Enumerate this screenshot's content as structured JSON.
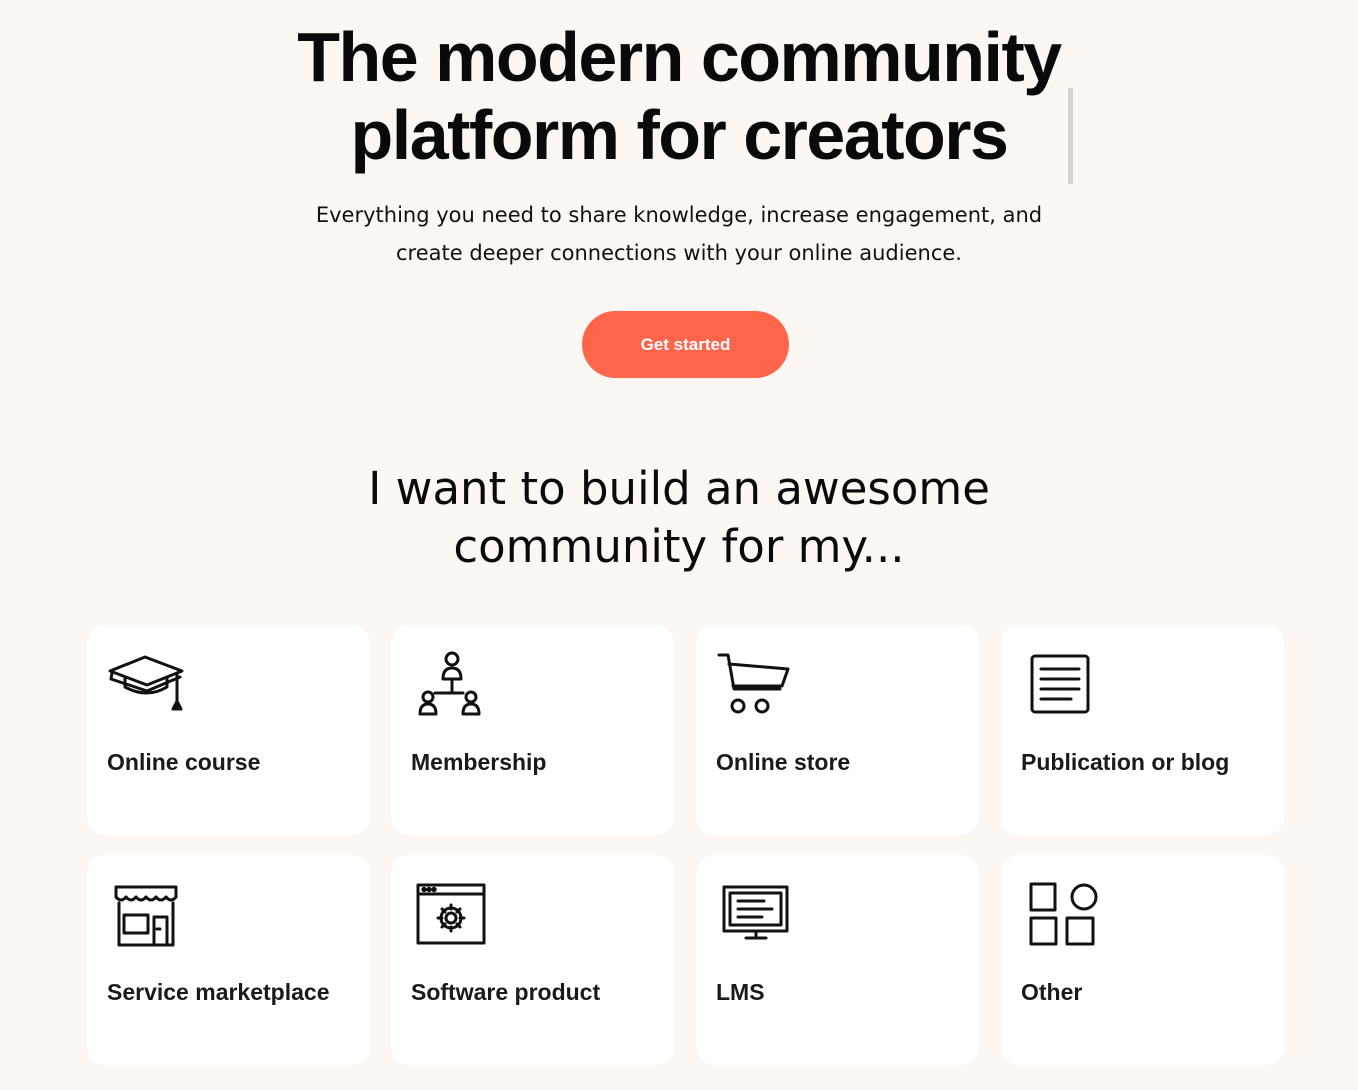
{
  "hero": {
    "title_line1": "The modern community",
    "title_line2": "platform for creators",
    "subtitle_line1": "Everything you need to share knowledge, increase engagement, and",
    "subtitle_line2": "create deeper connections with your online audience.",
    "cta_label": "Get started",
    "cta_color": "#fe654a"
  },
  "section": {
    "heading_line1": "I want to build an awesome",
    "heading_line2": "community for my..."
  },
  "options": [
    {
      "label": "Online course",
      "icon": "graduation-cap-icon"
    },
    {
      "label": "Membership",
      "icon": "people-network-icon"
    },
    {
      "label": "Online store",
      "icon": "shopping-cart-icon"
    },
    {
      "label": "Publication or blog",
      "icon": "document-icon"
    },
    {
      "label": "Service marketplace",
      "icon": "storefront-icon"
    },
    {
      "label": "Software product",
      "icon": "software-window-gear-icon"
    },
    {
      "label": "LMS",
      "icon": "monitor-icon"
    },
    {
      "label": "Other",
      "icon": "shapes-grid-icon"
    }
  ],
  "colors": {
    "background": "#fdf7f4",
    "card": "#ffffff",
    "text": "#0a0a0a"
  }
}
